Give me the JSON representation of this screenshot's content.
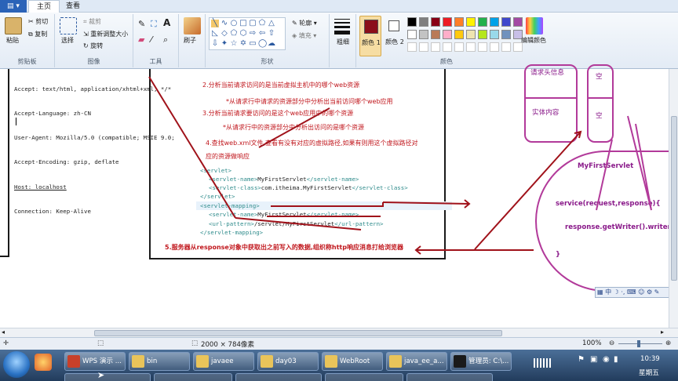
{
  "menu": {
    "file_label": "▤ ▾",
    "tabs": [
      "主页",
      "查看"
    ]
  },
  "ribbon": {
    "clipboard": {
      "paste": "粘贴",
      "cut": "剪切",
      "copy": "复制",
      "label": "剪贴板"
    },
    "image": {
      "select": "选择",
      "crop": "裁剪",
      "resize": "重新调整大小",
      "rotate": "旋转",
      "label": "图像"
    },
    "tools": {
      "label": "工具"
    },
    "brushes": {
      "label": "刷子"
    },
    "shapes": {
      "outline": "轮廓",
      "fill": "填充",
      "label": "形状"
    },
    "size": {
      "label": "粗细"
    },
    "colors": {
      "color1": "颜色 1",
      "color2": "颜色 2",
      "edit": "编辑颜色",
      "label": "颜色",
      "color1_value": "#8b0f1a",
      "color2_value": "#ffffff",
      "palette_row1": [
        "#000000",
        "#7f7f7f",
        "#880015",
        "#ed1c24",
        "#ff7f27",
        "#fff200",
        "#22b14c",
        "#00a2e8",
        "#3f48cc",
        "#a349a4"
      ],
      "palette_row2": [
        "#ffffff",
        "#c3c3c3",
        "#b97a57",
        "#ffaec9",
        "#ffc90e",
        "#efe4b0",
        "#b5e61d",
        "#99d9ea",
        "#7092be",
        "#c8bfe7"
      ]
    }
  },
  "terminal": {
    "lines": [
      "Accept: text/html, application/xhtml+xml, */*",
      "Accept-Language: zh-CN",
      "User-Agent: Mozilla/5.0 (compatible; MSIE 9.0;",
      "Accept-Encoding: gzip, deflate",
      "Host: localhost",
      "Connection: Keep-Alive"
    ]
  },
  "notes": {
    "step2": "2.分析当前请求访问的是当前虚拟主机中的哪个web资源",
    "step2_sub": "*从请求行中请求的资源部分中分析出当前访问哪个web应用",
    "step3": "3.分析当前请求要访问的是这个web应用中的哪个资源",
    "step3_sub": "*从请求行中的资源部分中分析出访问的是哪个资源",
    "step4_line1": "4.查找web.xml文件,查看有没有对应的虚拟路径,如果有则用这个虚拟路径对",
    "step4_line2": "应的资源做响应",
    "step5": "5.服务器从response对象中获取出之前写入的数据,组织称http响应消息打给浏览器"
  },
  "xml": {
    "servlet_open": "<servlet>",
    "servlet_name_open": "<servlet-name>",
    "servlet_name_value": "MyFirstServlet",
    "servlet_name_close": "</servlet-name>",
    "servlet_class_open": "<servlet-class>",
    "servlet_class_value": "com.itheima.MyFirstServlet",
    "servlet_class_close": "</servlet-class>",
    "servlet_close": "</servlet>",
    "mapping_open": "<servlet-mapping>",
    "mapping_name_value": "MyFirstServlet",
    "url_pattern_open": "<url-pattern>",
    "url_pattern_value": "/servlet/MyFirstServlet",
    "url_pattern_close": "</url-pattern>",
    "mapping_close": "</servlet-mapping>"
  },
  "diagram": {
    "request_header": "请求头信息",
    "empty1": "空",
    "entity": "实体内容",
    "empty2": "空",
    "servlet": "MyFirstServlet",
    "service": "service(request,response){",
    "writer": "response.getWriter().writer(\"",
    "brace": "}"
  },
  "ime": {
    "label": "中"
  },
  "status": {
    "dimensions": "2000 × 784像素",
    "zoom": "100%"
  },
  "taskbar": {
    "items": [
      {
        "label": "WPS 演示 ...",
        "color": "#c8402a"
      },
      {
        "label": "bin",
        "color": "#e9c45a"
      },
      {
        "label": "javaee",
        "color": "#e9c45a"
      },
      {
        "label": "day03",
        "color": "#e9c45a"
      },
      {
        "label": "WebRoot",
        "color": "#e9c45a"
      },
      {
        "label": "java_ee_a...",
        "color": "#e9c45a"
      },
      {
        "label": "管理员: C:\\...",
        "color": "#1a1a1a"
      }
    ],
    "time": "10:39",
    "day": "星期五"
  }
}
